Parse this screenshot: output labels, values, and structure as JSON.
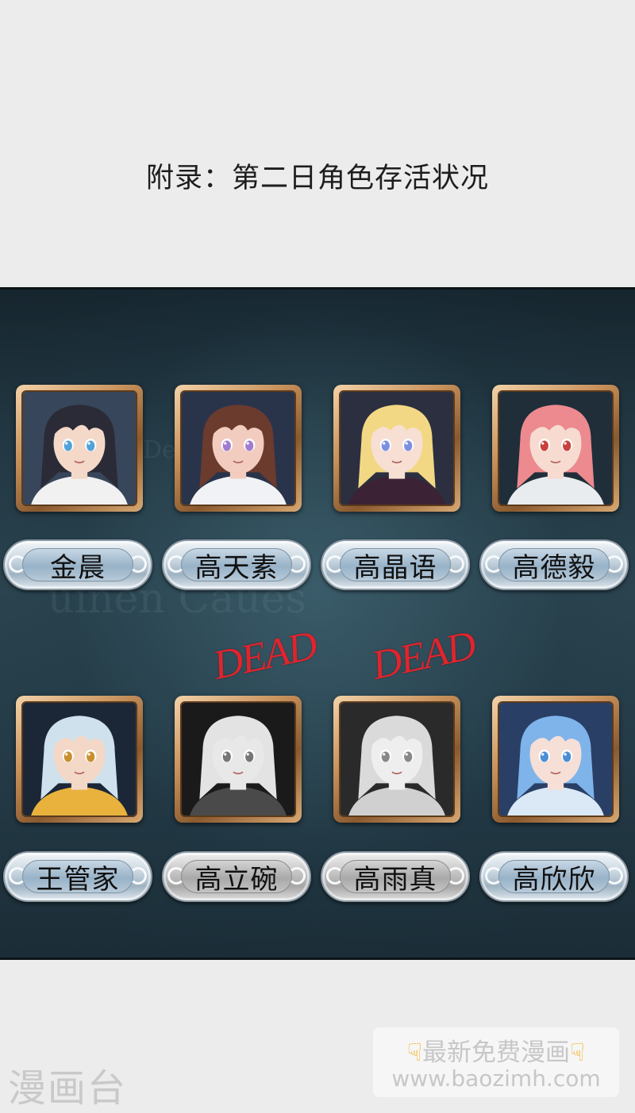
{
  "title": "附录：第二日角色存活状况",
  "status_mark": "DEAD",
  "colors": {
    "dead_mark": "#e0242d",
    "card_frame": "#c8925d",
    "panel_bg": "#243b47"
  },
  "characters": [
    {
      "name": "金晨",
      "status": "alive",
      "hair": "#2a2b36",
      "skin": "#f4d8c8",
      "eyes": "#4fa3d8",
      "clothes": "#f1f1f1",
      "bg": "#37465a"
    },
    {
      "name": "高天素",
      "status": "alive",
      "hair": "#6b3b2e",
      "skin": "#f2cdbf",
      "eyes": "#9f7cd0",
      "clothes": "#f0f2f5",
      "bg": "#29344b"
    },
    {
      "name": "高晶语",
      "status": "alive",
      "hair": "#f2d884",
      "skin": "#f7dfd4",
      "eyes": "#7d8fe0",
      "clothes": "#3b2234",
      "bg": "#2c2f40"
    },
    {
      "name": "高德毅",
      "status": "alive",
      "hair": "#ec8a8f",
      "skin": "#f7dbd0",
      "eyes": "#c9413b",
      "clothes": "#e8ecef",
      "bg": "#1f2e39"
    },
    {
      "name": "王管家",
      "status": "alive",
      "hair": "#cfe1ec",
      "skin": "#f3d8c7",
      "eyes": "#c9902f",
      "clothes": "#e8b23d",
      "bg": "#1b2637"
    },
    {
      "name": "高立碗",
      "status": "dead",
      "hair": "#e3e3e3",
      "skin": "#e8e8e8",
      "eyes": "#777777",
      "clothes": "#4a4a4a",
      "bg": "#1a1a1a"
    },
    {
      "name": "高雨真",
      "status": "dead",
      "hair": "#dadada",
      "skin": "#eeeeee",
      "eyes": "#888888",
      "clothes": "#d0d0d0",
      "bg": "#2a2a2a"
    },
    {
      "name": "高欣欣",
      "status": "alive",
      "hair": "#7fb4ea",
      "skin": "#f6dfd6",
      "eyes": "#4a8fd6",
      "clothes": "#dbe9f6",
      "bg": "#2a3f66"
    }
  ],
  "watermark": {
    "line1_left_icon": "pointing-down-hand-icon",
    "line1_text": "最新免费漫画",
    "line1_right_icon": "pointing-down-hand-icon",
    "line2_text": "www.baozimh.com"
  },
  "site_logo": "漫画台",
  "background_decor_text": [
    "De  er  i     ss",
    "uinen  Caues"
  ]
}
